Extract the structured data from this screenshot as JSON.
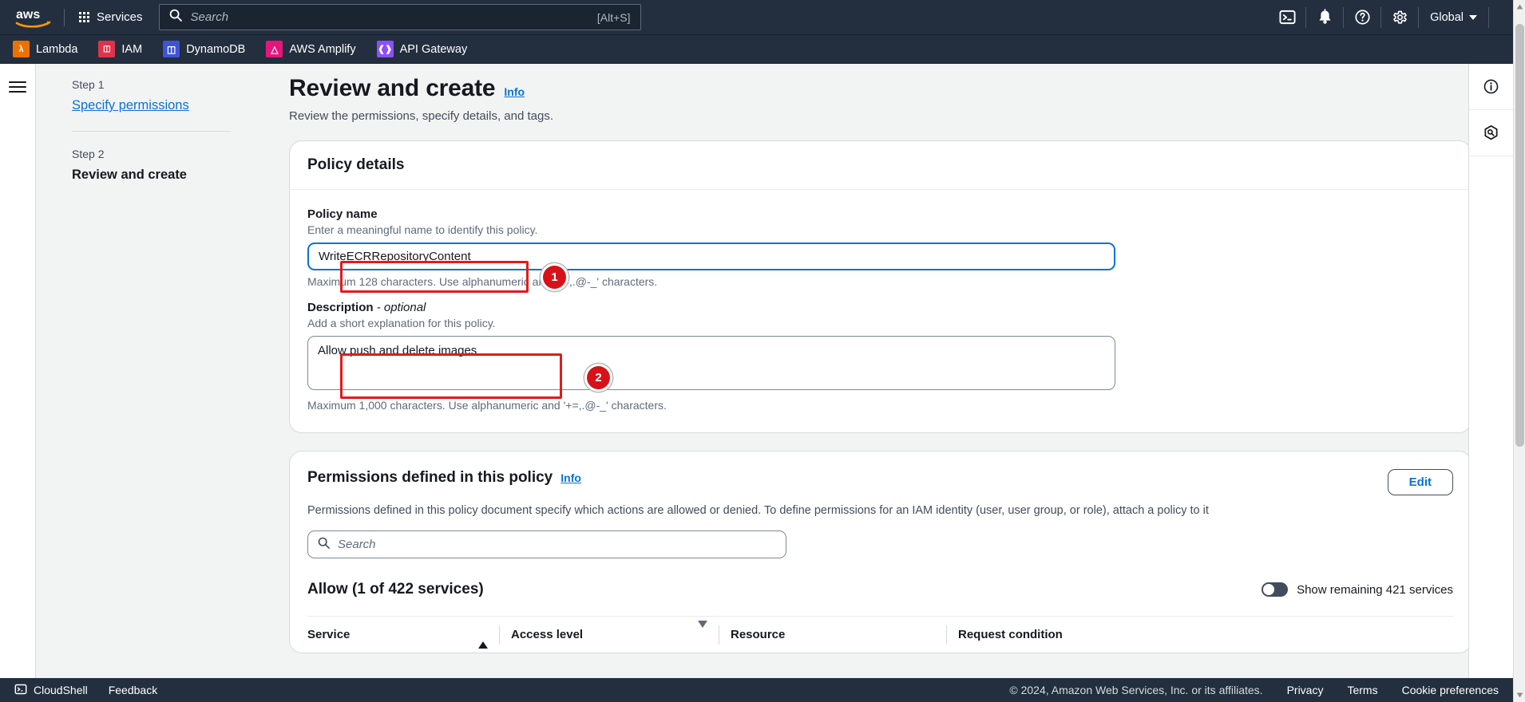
{
  "topnav": {
    "logo_alt": "aws",
    "services_label": "Services",
    "search_placeholder": "Search",
    "search_value": "",
    "search_shortcut": "[Alt+S]",
    "icons": [
      "cloudshell-icon",
      "notifications-bell-icon",
      "help-question-icon",
      "settings-gear-icon"
    ],
    "region_label": "Global"
  },
  "favorites": [
    {
      "label": "Lambda",
      "color": "#ED7100",
      "glyph": "λ"
    },
    {
      "label": "IAM",
      "color": "#DD344C",
      "glyph": "≡"
    },
    {
      "label": "DynamoDB",
      "color": "#4053D6",
      "glyph": "⛁"
    },
    {
      "label": "AWS Amplify",
      "color": "#E7157B",
      "glyph": "△"
    },
    {
      "label": "API Gateway",
      "color": "#8C4FFF",
      "glyph": "⟺"
    }
  ],
  "wizard": {
    "step1_number": "Step 1",
    "step1_label": "Specify permissions",
    "step2_number": "Step 2",
    "step2_label": "Review and create"
  },
  "page": {
    "title": "Review and create",
    "info_label": "Info",
    "subtitle": "Review the permissions, specify details, and tags."
  },
  "policy_details": {
    "card_title": "Policy details",
    "name_label": "Policy name",
    "name_description": "Enter a meaningful name to identify this policy.",
    "name_value": "WriteECRRepositoryContent",
    "name_hint": "Maximum 128 characters. Use alphanumeric and '+=,.@-_' characters.",
    "description_label": "Description",
    "description_optional": "- optional",
    "description_description": "Add a short explanation for this policy.",
    "description_value": "Allow push and delete images",
    "description_hint": "Maximum 1,000 characters. Use alphanumeric and '+=,.@-_' characters."
  },
  "permissions": {
    "title": "Permissions defined in this policy",
    "info_label": "Info",
    "edit_label": "Edit",
    "description": "Permissions defined in this policy document specify which actions are allowed or denied. To define permissions for an IAM identity (user, user group, or role), attach a policy to it",
    "search_placeholder": "Search",
    "search_value": "",
    "allow_heading": "Allow (1 of 422 services)",
    "toggle_label": "Show remaining 421 services",
    "toggle_on": false,
    "columns": [
      {
        "label": "Service",
        "sort": "asc"
      },
      {
        "label": "Access level",
        "sort": "desc"
      },
      {
        "label": "Resource",
        "sort": "none"
      },
      {
        "label": "Request condition",
        "sort": "none"
      }
    ]
  },
  "right_rail": {
    "buttons": [
      "info-circle-icon",
      "security-hexagon-icon"
    ]
  },
  "footer": {
    "cloudshell_label": "CloudShell",
    "feedback_label": "Feedback",
    "copyright": "© 2024, Amazon Web Services, Inc. or its affiliates.",
    "links": [
      "Privacy",
      "Terms",
      "Cookie preferences"
    ]
  },
  "annotations": [
    {
      "number": "1",
      "target": "policy-name-input"
    },
    {
      "number": "2",
      "target": "policy-description-textarea"
    }
  ],
  "colors": {
    "nav_bg": "#232f3e",
    "accent_link": "#0972d3",
    "annotation_red": "#d81118",
    "page_bg": "#f2f3f3"
  }
}
